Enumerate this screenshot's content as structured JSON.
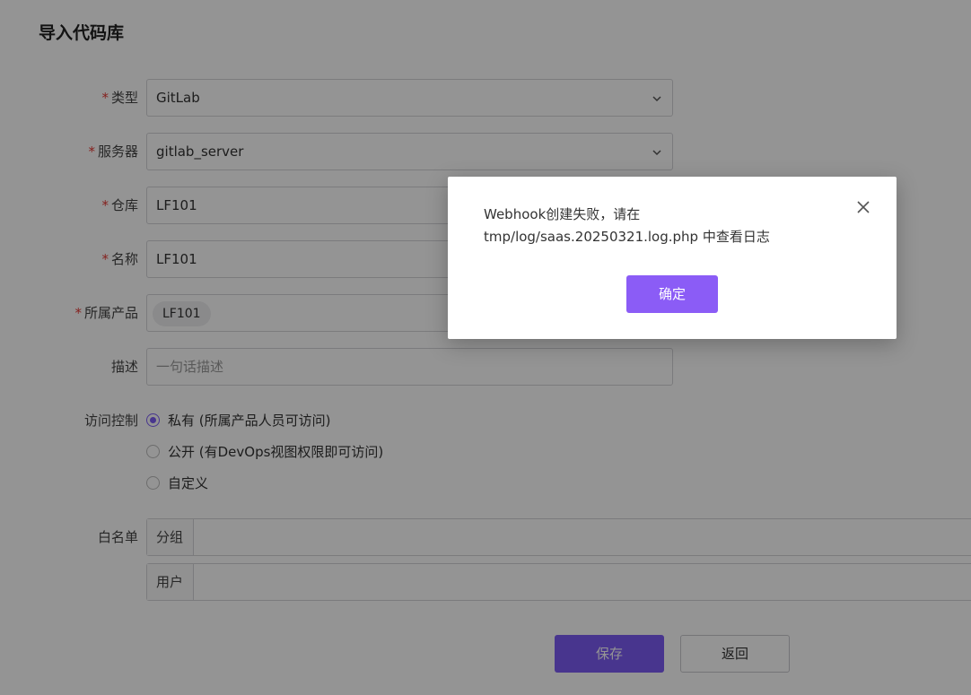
{
  "page": {
    "title": "导入代码库"
  },
  "form": {
    "required_mark": "*",
    "type": {
      "label": "类型",
      "value": "GitLab"
    },
    "server": {
      "label": "服务器",
      "value": "gitlab_server"
    },
    "repo": {
      "label": "仓库",
      "value": "LF101"
    },
    "name": {
      "label": "名称",
      "value": "LF101"
    },
    "product": {
      "label": "所属产品",
      "chip": "LF101"
    },
    "description": {
      "label": "描述",
      "placeholder": "一句话描述"
    },
    "access": {
      "label": "访问控制",
      "options": [
        {
          "label": "私有 (所属产品人员可访问)",
          "selected": true
        },
        {
          "label": "公开 (有DevOps视图权限即可访问)",
          "selected": false
        },
        {
          "label": "自定义",
          "selected": false
        }
      ]
    },
    "whitelist": {
      "label": "白名单",
      "group_addon": "分组",
      "user_addon": "用户"
    }
  },
  "actions": {
    "save": "保存",
    "back": "返回"
  },
  "dialog": {
    "message_line1": "Webhook创建失败，请在",
    "message_line2": "tmp/log/saas.20250321.log.php 中查看日志",
    "ok": "确定"
  },
  "colors": {
    "accent": "#7c5cf5",
    "required": "#e53935"
  }
}
